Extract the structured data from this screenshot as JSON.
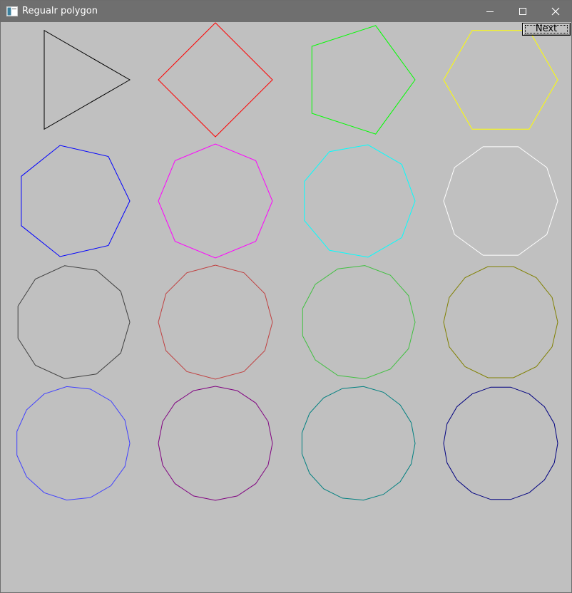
{
  "window": {
    "title": "Regualr polygon",
    "icon": "app-window-icon",
    "controls": [
      "minimize-icon",
      "maximize-icon",
      "close-icon"
    ]
  },
  "toolbar": {
    "next_label": "Next"
  },
  "polygons": [
    {
      "sides": 3,
      "color": "#000000"
    },
    {
      "sides": 4,
      "color": "#ff0000"
    },
    {
      "sides": 5,
      "color": "#00ff00"
    },
    {
      "sides": 6,
      "color": "#ffff00"
    },
    {
      "sides": 7,
      "color": "#0000ff"
    },
    {
      "sides": 8,
      "color": "#ff00ff"
    },
    {
      "sides": 9,
      "color": "#00ffff"
    },
    {
      "sides": 10,
      "color": "#ffffff"
    },
    {
      "sides": 11,
      "color": "#404040"
    },
    {
      "sides": 12,
      "color": "#c04040"
    },
    {
      "sides": 13,
      "color": "#40c040"
    },
    {
      "sides": 14,
      "color": "#808000"
    },
    {
      "sides": 15,
      "color": "#4040ff"
    },
    {
      "sides": 16,
      "color": "#800080"
    },
    {
      "sides": 17,
      "color": "#008080"
    },
    {
      "sides": 18,
      "color": "#000080"
    }
  ]
}
